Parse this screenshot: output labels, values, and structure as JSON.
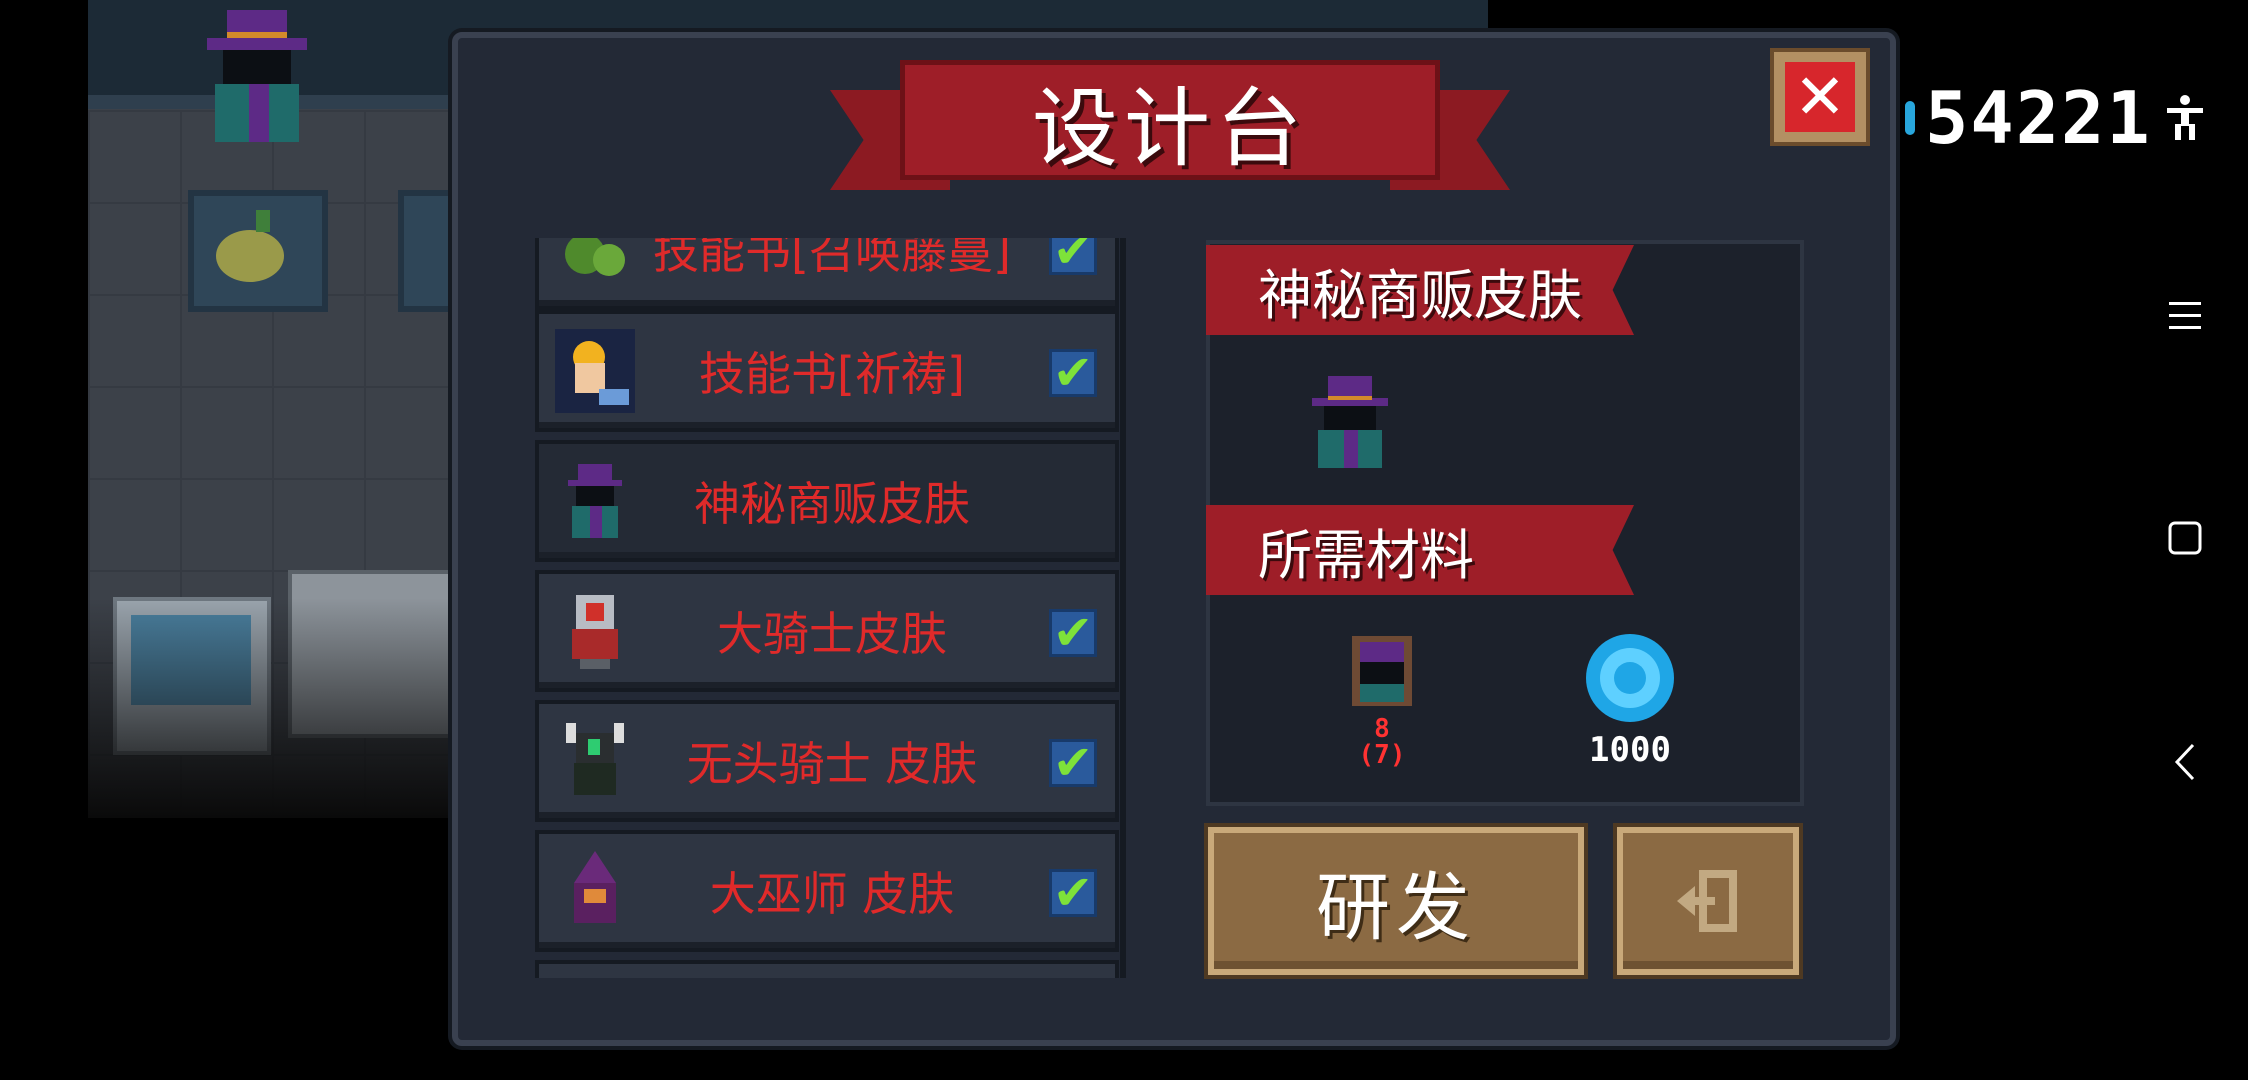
{
  "title": "设计台",
  "currency_counter": "54221",
  "recipes": [
    {
      "label": "技能书[召唤藤蔓]",
      "checked": true,
      "icon": "vine-icon"
    },
    {
      "label": "技能书[祈祷]",
      "checked": true,
      "icon": "pray-hand-icon"
    },
    {
      "label": "神秘商贩皮肤",
      "checked": false,
      "icon": "merchant-icon"
    },
    {
      "label": "大骑士皮肤",
      "checked": true,
      "icon": "knight-icon"
    },
    {
      "label": "无头骑士 皮肤",
      "checked": true,
      "icon": "headless-knight-icon"
    },
    {
      "label": "大巫师 皮肤",
      "checked": true,
      "icon": "wizard-icon"
    }
  ],
  "detail": {
    "name": "神秘商贩皮肤",
    "materials_title": "所需材料",
    "materials": [
      {
        "icon": "merchant-portrait-icon",
        "required": "8",
        "owned": "(7)"
      },
      {
        "icon": "gem-icon",
        "amount": "1000"
      }
    ]
  },
  "buttons": {
    "develop": "研发",
    "exit_icon": "exit-icon"
  },
  "check_mark": "✔",
  "close_mark": "✕"
}
